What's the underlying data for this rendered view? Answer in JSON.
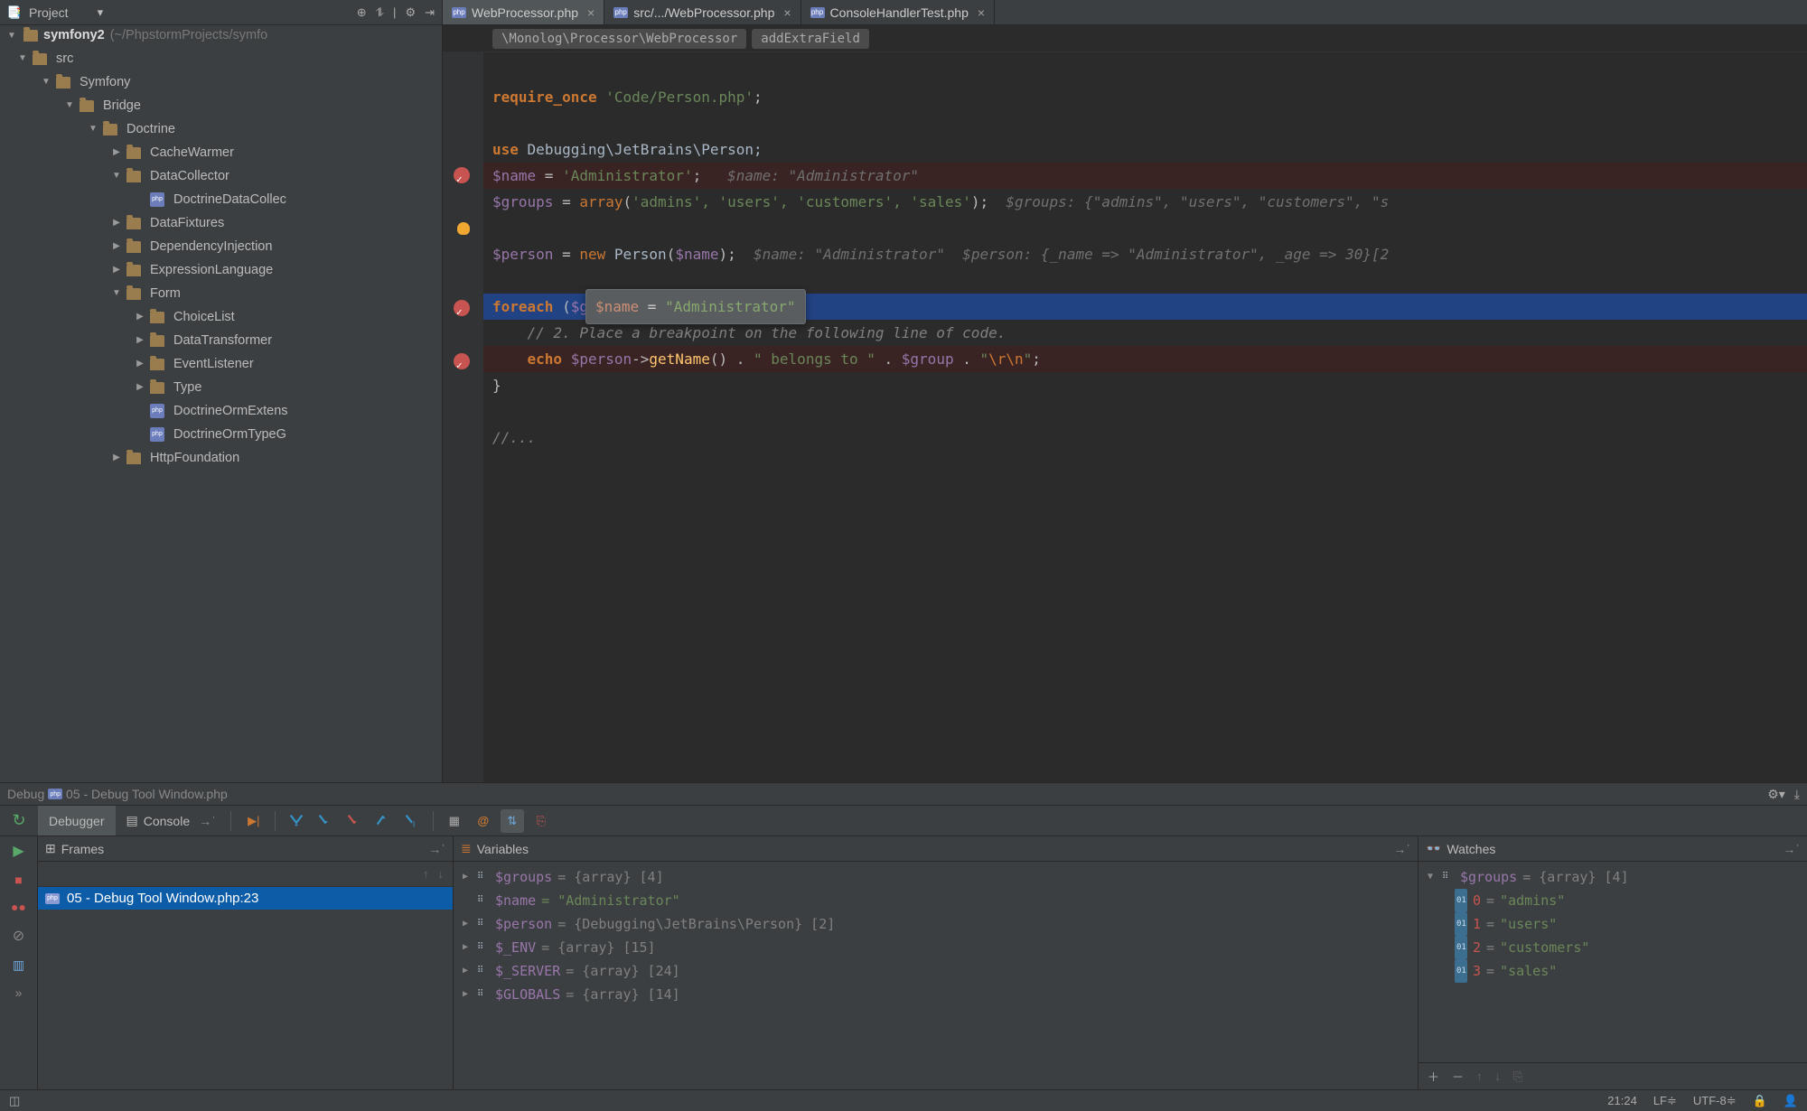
{
  "project": {
    "label": "Project",
    "root_name": "symfony2",
    "root_path": "(~/PhpstormProjects/symfo",
    "tree": [
      {
        "depth": 0,
        "tw": "▼",
        "icon": "folder",
        "label": "src"
      },
      {
        "depth": 1,
        "tw": "▼",
        "icon": "folder",
        "label": "Symfony"
      },
      {
        "depth": 2,
        "tw": "▼",
        "icon": "folder",
        "label": "Bridge"
      },
      {
        "depth": 3,
        "tw": "▼",
        "icon": "folder",
        "label": "Doctrine"
      },
      {
        "depth": 4,
        "tw": "▶",
        "icon": "folder",
        "label": "CacheWarmer"
      },
      {
        "depth": 4,
        "tw": "▼",
        "icon": "folder",
        "label": "DataCollector"
      },
      {
        "depth": 5,
        "tw": "",
        "icon": "php",
        "label": "DoctrineDataCollec"
      },
      {
        "depth": 4,
        "tw": "▶",
        "icon": "folder",
        "label": "DataFixtures"
      },
      {
        "depth": 4,
        "tw": "▶",
        "icon": "folder",
        "label": "DependencyInjection"
      },
      {
        "depth": 4,
        "tw": "▶",
        "icon": "folder",
        "label": "ExpressionLanguage"
      },
      {
        "depth": 4,
        "tw": "▼",
        "icon": "folder",
        "label": "Form"
      },
      {
        "depth": 5,
        "tw": "▶",
        "icon": "folder",
        "label": "ChoiceList"
      },
      {
        "depth": 5,
        "tw": "▶",
        "icon": "folder",
        "label": "DataTransformer"
      },
      {
        "depth": 5,
        "tw": "▶",
        "icon": "folder",
        "label": "EventListener"
      },
      {
        "depth": 5,
        "tw": "▶",
        "icon": "folder",
        "label": "Type"
      },
      {
        "depth": 5,
        "tw": "",
        "icon": "php",
        "label": "DoctrineOrmExtens"
      },
      {
        "depth": 5,
        "tw": "",
        "icon": "php",
        "label": "DoctrineOrmTypeG"
      },
      {
        "depth": 4,
        "tw": "▶",
        "icon": "folder",
        "label": "HttpFoundation"
      }
    ]
  },
  "tabs": [
    {
      "label": "WebProcessor.php",
      "active": true
    },
    {
      "label": "src/.../WebProcessor.php",
      "active": false
    },
    {
      "label": "ConsoleHandlerTest.php",
      "active": false
    }
  ],
  "breadcrumb": [
    "\\Monolog\\Processor\\WebProcessor",
    "addExtraField"
  ],
  "code": {
    "require": "'Code/Person.php'",
    "use": "Debugging\\JetBrains\\Person;",
    "name_assign": "'Administrator'",
    "name_hint": "$name: \"Administrator\"",
    "groups_items": "'admins', 'users', 'customers', 'sales'",
    "groups_hint": "$groups: {\"admins\", \"users\", \"customers\", \"s",
    "person_hint1": "$name: \"Administrator\"",
    "person_hint2": "$person: {_name => \"Administrator\", _age => 30}[2",
    "foreach_partial": "$gr",
    "comment2": "// 2. Place a breakpoint on the following line of code.",
    "echo_tail1": "\" belongs to \"",
    "echo_tail2": "\"\\r\\n\"",
    "collapsed": "//..."
  },
  "tooltip": {
    "var": "$name",
    "eq": " = ",
    "val": "\"Administrator\""
  },
  "debug_title_prefix": "Debug",
  "debug_title": "05 - Debug Tool Window.php",
  "debugger_tab": "Debugger",
  "console_tab": "Console",
  "frames": {
    "title": "Frames",
    "item": "05 - Debug Tool Window.php:23"
  },
  "variables": {
    "title": "Variables",
    "rows": [
      {
        "tw": "▶",
        "name": "$groups",
        "rest": " = {array} [4]",
        "type": "type"
      },
      {
        "tw": "",
        "name": "$name",
        "rest": " = \"Administrator\"",
        "type": "str"
      },
      {
        "tw": "▶",
        "name": "$person",
        "rest": " = {Debugging\\JetBrains\\Person} [2]",
        "type": "type"
      },
      {
        "tw": "▶",
        "name": "$_ENV",
        "rest": " = {array} [15]",
        "type": "type"
      },
      {
        "tw": "▶",
        "name": "$_SERVER",
        "rest": " = {array} [24]",
        "type": "type"
      },
      {
        "tw": "▶",
        "name": "$GLOBALS",
        "rest": " = {array} [14]",
        "type": "type"
      }
    ]
  },
  "watches": {
    "title": "Watches",
    "root": {
      "name": "$groups",
      "rest": " = {array} [4]"
    },
    "items": [
      {
        "key": "0",
        "val": "\"admins\""
      },
      {
        "key": "1",
        "val": "\"users\""
      },
      {
        "key": "2",
        "val": "\"customers\""
      },
      {
        "key": "3",
        "val": "\"sales\""
      }
    ]
  },
  "status": {
    "pos": "21:24",
    "le": "LF≑",
    "enc": "UTF-8≑"
  }
}
